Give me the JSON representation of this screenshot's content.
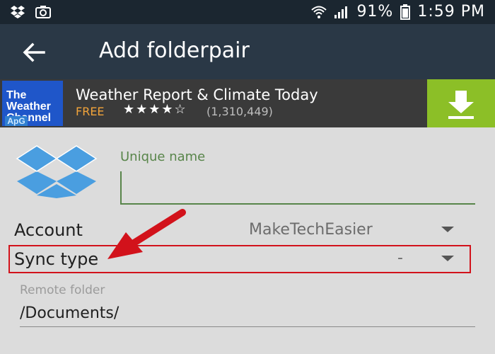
{
  "status": {
    "battery_pct": "91%",
    "time": "1:59 PM"
  },
  "appbar": {
    "title": "Add folderpair"
  },
  "ad": {
    "logo_text": "The Weather Channel",
    "badge": "ApG",
    "title": "Weather Report & Climate Today",
    "price": "FREE",
    "rating_stars": "★★★★☆",
    "rating_count": "(1,310,449)",
    "accent": "#8cbf27"
  },
  "form": {
    "unique_name_label": "Unique name",
    "unique_name_value": "",
    "account_label": "Account",
    "account_value": "MakeTechEasier",
    "sync_type_label": "Sync type",
    "sync_type_value": "-",
    "remote_folder_label": "Remote folder",
    "remote_folder_value": "/Documents/"
  },
  "colors": {
    "appbar": "#2a3846",
    "highlight": "#d2121b",
    "field_accent": "#58854a"
  }
}
